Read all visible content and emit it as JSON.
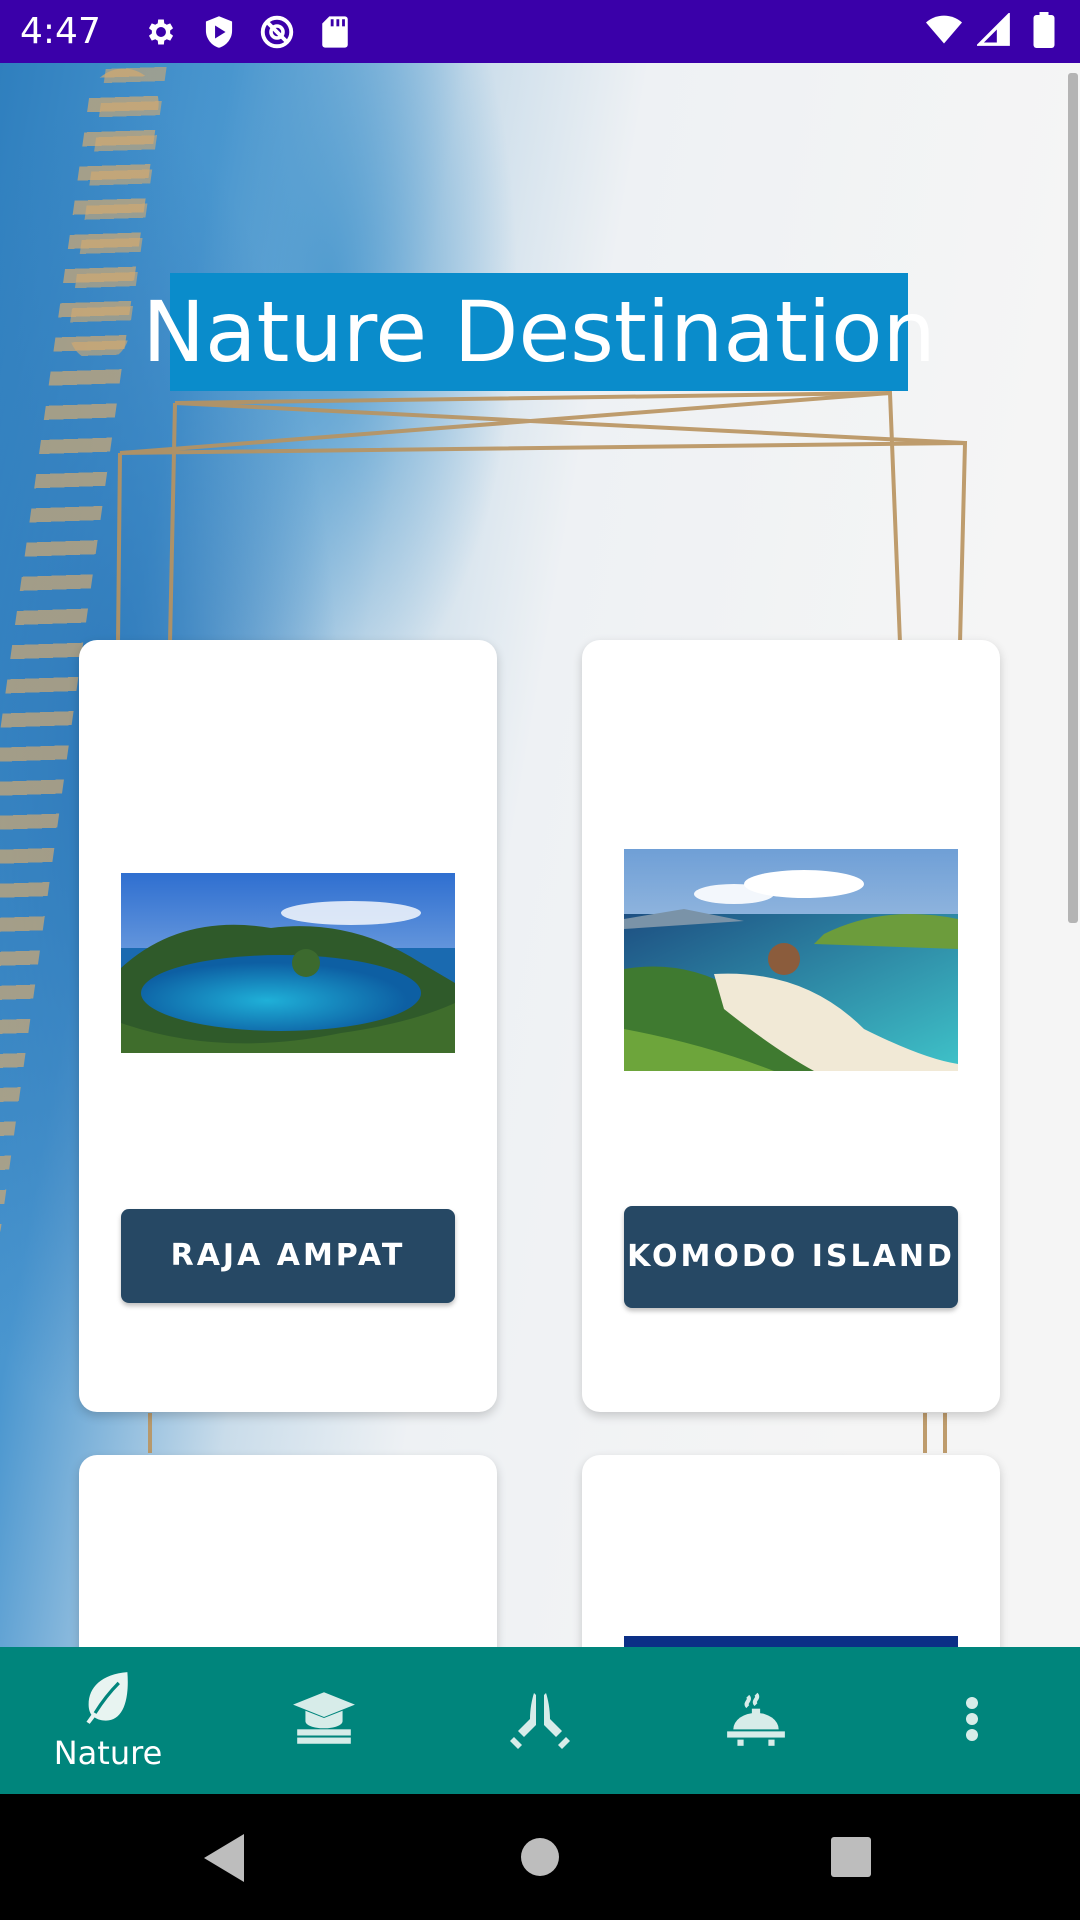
{
  "status_bar": {
    "time": "4:47",
    "left_icons": [
      "settings-icon",
      "play-protect-icon",
      "no-disturb-icon",
      "sd-card-icon"
    ],
    "right_icons": [
      "wifi-icon",
      "signal-icon",
      "battery-icon"
    ]
  },
  "header": {
    "title": "Nature Destination"
  },
  "cards": [
    {
      "label": "RAJA AMPAT",
      "image": "raja-ampat-photo"
    },
    {
      "label": "KOMODO ISLAND",
      "image": "komodo-island-photo"
    },
    {
      "label": "",
      "image": ""
    },
    {
      "label": "",
      "image": ""
    }
  ],
  "bottom_nav": {
    "items": [
      {
        "icon": "leaf-icon",
        "label": "Nature",
        "active": true
      },
      {
        "icon": "education-icon",
        "label": ""
      },
      {
        "icon": "temple-icon",
        "label": ""
      },
      {
        "icon": "cuisine-icon",
        "label": ""
      },
      {
        "icon": "more-vert-icon",
        "label": ""
      }
    ]
  },
  "system_nav": [
    "back-icon",
    "home-icon",
    "recents-icon"
  ],
  "colors": {
    "status_bar": "#3a00a9",
    "title_bg": "#0a8ccb",
    "button": "#264864",
    "bottom_nav": "#00857c"
  }
}
